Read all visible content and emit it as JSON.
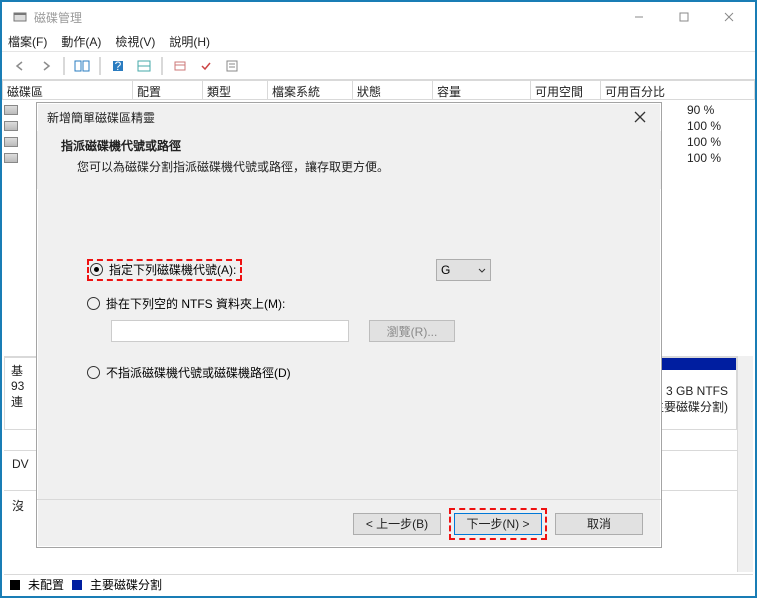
{
  "window": {
    "title": "磁碟管理",
    "menus": [
      "檔案(F)",
      "動作(A)",
      "檢視(V)",
      "說明(H)"
    ]
  },
  "columns": [
    "磁碟區",
    "配置",
    "類型",
    "檔案系統",
    "狀態",
    "容量",
    "可用空間",
    "可用百分比"
  ],
  "bg": {
    "rows": [
      {
        "percent": "90 %"
      },
      {
        "percent": "100 %"
      },
      {
        "percent": "100 %"
      },
      {
        "percent": "100 %"
      }
    ],
    "disk_panel": {
      "left_line0": "基",
      "left_line1": "93",
      "left_line2": "連",
      "right_line0": "3 GB NTFS",
      "right_line1": "主要磁碟分割)"
    },
    "lower2_prefix": "DV",
    "lower3_text": "沒",
    "legend_unalloc": "未配置",
    "legend_primary": "主要磁碟分割"
  },
  "wizard": {
    "title": "新增簡單磁碟區精靈",
    "heading": "指派磁碟機代號或路徑",
    "subheading": "您可以為磁碟分割指派磁碟機代號或路徑，讓存取更方便。",
    "opt_assign": "指定下列磁碟機代號(A):",
    "drive_letter": "G",
    "opt_mount": "掛在下列空的 NTFS 資料夾上(M):",
    "browse": "瀏覽(R)...",
    "opt_none": "不指派磁碟機代號或磁碟機路徑(D)",
    "back": "< 上一步(B)",
    "next": "下一步(N) >",
    "cancel": "取消"
  }
}
